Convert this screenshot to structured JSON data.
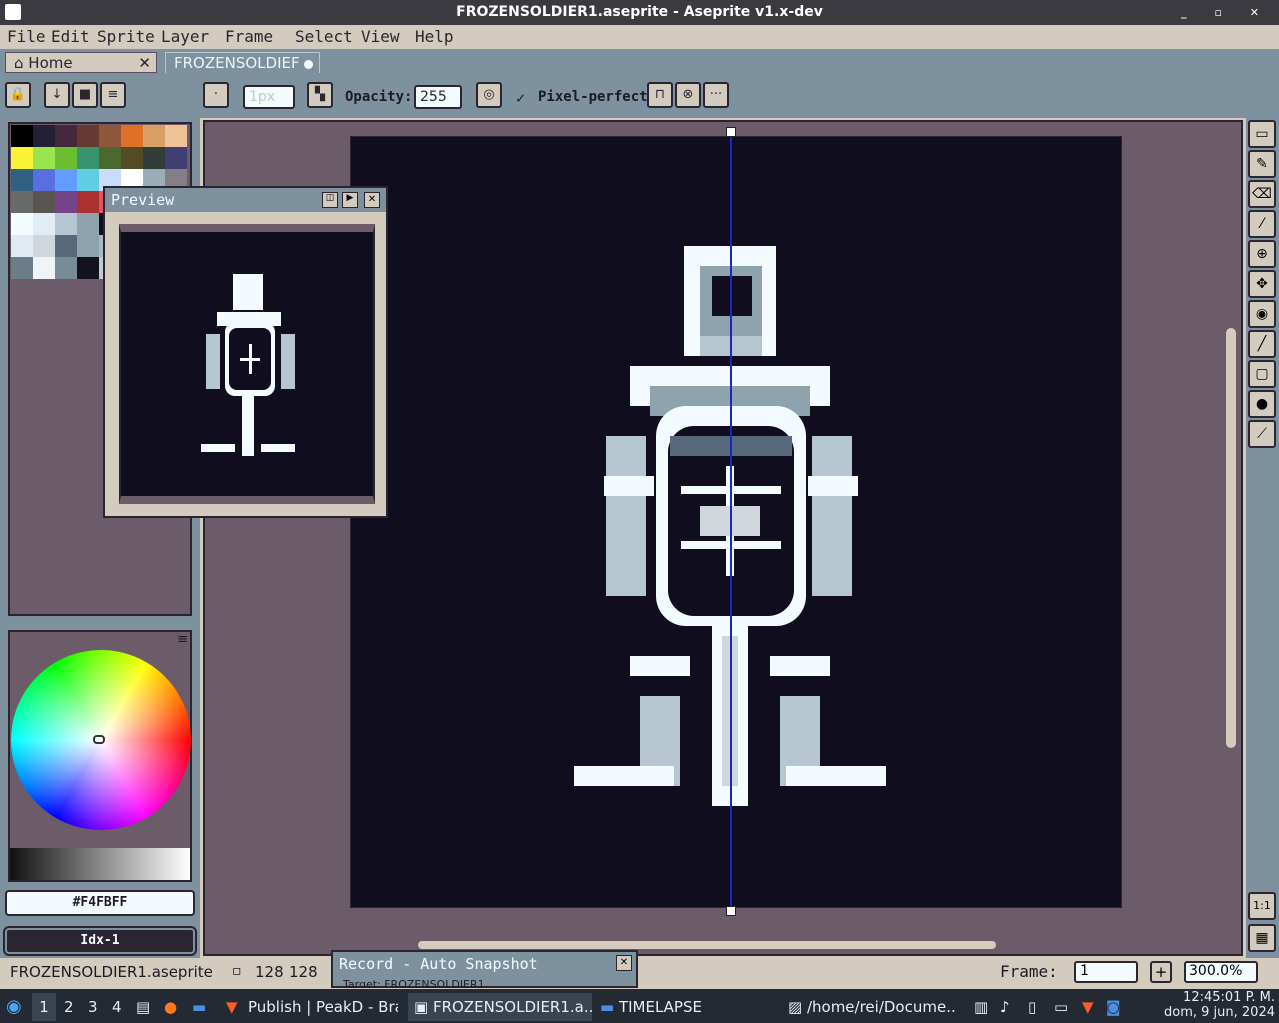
{
  "window": {
    "title": "FROZENSOLDIER1.aseprite - Aseprite v1.x-dev",
    "controls": "_ ▫ ✕"
  },
  "menu": [
    "File",
    "Edit",
    "Sprite",
    "Layer",
    "Frame",
    "Select",
    "View",
    "Help"
  ],
  "tabs": {
    "home": "Home",
    "file": "FROZENSOLDIEF",
    "close": "✕"
  },
  "toolbar": {
    "brush_size": "1px",
    "opacity_label": "Opacity:",
    "opacity_value": "255",
    "pixel_perfect": "Pixel-perfect",
    "check": "✓",
    "more": "···"
  },
  "palette": {
    "colors": [
      "#000000",
      "#222034",
      "#45283c",
      "#663931",
      "#8f563b",
      "#df7126",
      "#d9a066",
      "#eec39a",
      "#fbf236",
      "#99e550",
      "#6abe30",
      "#37946e",
      "#4b692f",
      "#524b24",
      "#323c39",
      "#3f3f74",
      "#306082",
      "#5b6ee1",
      "#639bff",
      "#5fcde4",
      "#cbdbfc",
      "#ffffff",
      "#9badb7",
      "#847e87",
      "#696a6a",
      "#595652",
      "#76428a",
      "#ac3232",
      "#d95763",
      "#d77bba",
      "#8f974a",
      "#8a6f30",
      "#f4fbff",
      "#e1ecf4",
      "#b5c6d0",
      "#8ea3ae",
      "#100d1e",
      "#2a2530",
      "#4b5866",
      "#6c7c88",
      "#dfeaf2",
      "#cfd6dc",
      "#56687a",
      "#8ca3ae",
      "#a8b8c2",
      "#fafafa",
      "#3a3a48",
      "#a0adb4",
      "#6b7d88",
      "#f0f4f8",
      "#788c98",
      "#15121f",
      "#c0ccd4",
      "#94a4ae",
      "#303848",
      "#d8e4ec"
    ]
  },
  "color": {
    "hex": "#F4FBFF",
    "index": "Idx-1"
  },
  "preview": {
    "title": "Preview"
  },
  "status": {
    "filename": "FROZENSOLDIER1.aseprite",
    "size_w": "128",
    "size_h": "128",
    "frame_label": "Frame:",
    "frame_value": "1",
    "zoom": "300.0%",
    "plus": "+"
  },
  "record": {
    "title": "Record - Auto Snapshot",
    "sub": "Target:   FROZENSOLDIER1"
  },
  "taskbar": {
    "workspaces": [
      "1",
      "2",
      "3",
      "4"
    ],
    "items": [
      "Publish | PeakD - Bra...",
      "FROZENSOLDIER1.a...",
      "TIMELAPSE",
      "/home/rei/Docume..."
    ],
    "clock_time": "12:45:01 P. M.",
    "clock_date": "dom, 9 jun, 2024"
  },
  "right_tools": [
    "▭",
    "✎",
    "⌫",
    "⁄",
    "⊕",
    "✥",
    "◉",
    "╱",
    "▢",
    "●",
    "⟋"
  ],
  "zoom_buttons": [
    "1:1",
    "▦"
  ]
}
